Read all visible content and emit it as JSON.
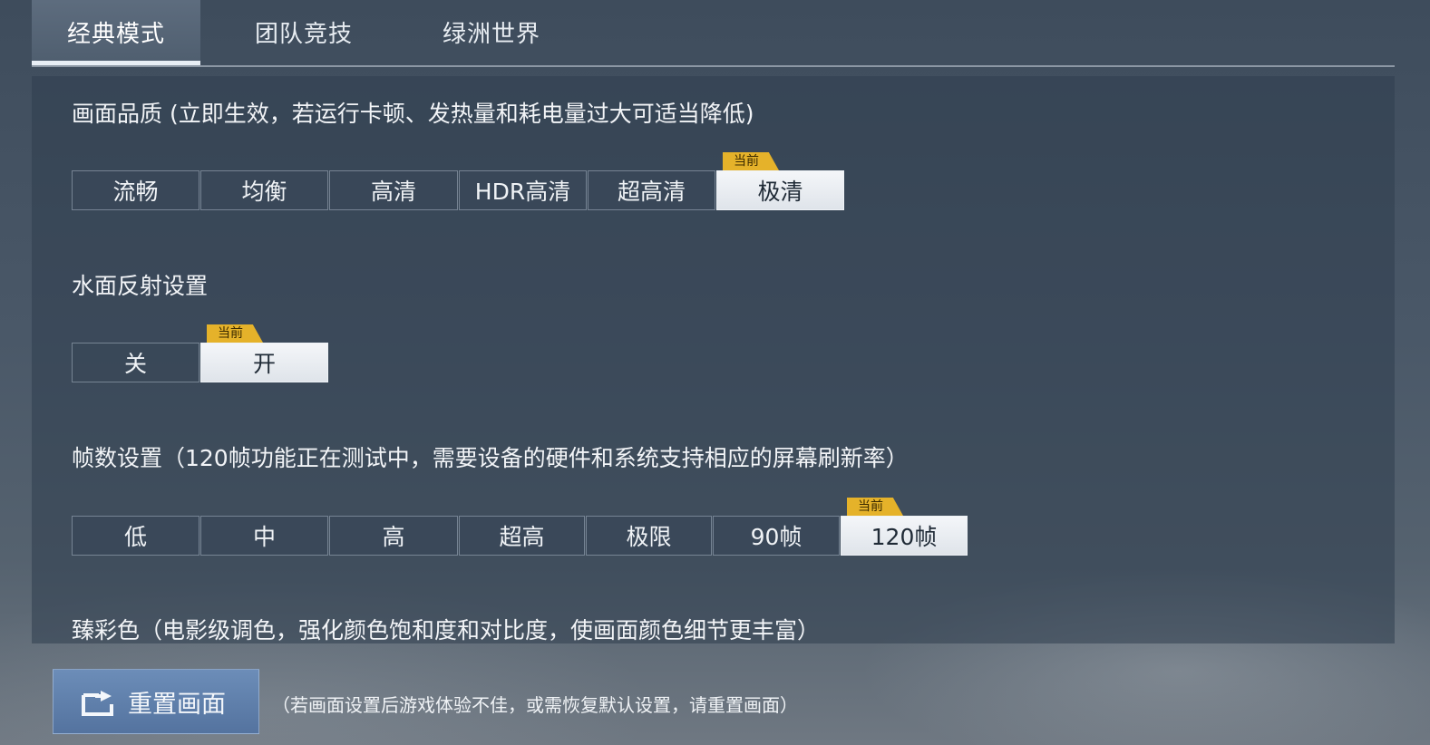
{
  "tabs": [
    "经典模式",
    "团队竞技",
    "绿洲世界"
  ],
  "sections": {
    "quality": {
      "title": "画面品质 (立即生效，若运行卡顿、发热量和耗电量过大可适当降低)",
      "options": [
        "流畅",
        "均衡",
        "高清",
        "HDR高清",
        "超高清",
        "极清"
      ],
      "selected_label": "极清"
    },
    "water": {
      "title": "水面反射设置",
      "options": [
        "关",
        "开"
      ],
      "selected_label": "开"
    },
    "fps": {
      "title": "帧数设置（120帧功能正在测试中，需要设备的硬件和系统支持相应的屏幕刷新率）",
      "options": [
        "低",
        "中",
        "高",
        "超高",
        "极限",
        "90帧",
        "120帧"
      ],
      "selected_label": "120帧"
    },
    "color": {
      "title": "臻彩色（电影级调色，强化颜色饱和度和对比度，使画面颜色细节更丰富）"
    }
  },
  "badge_label": "当前",
  "reset": {
    "label": "重置画面",
    "icon": "reset-screen-icon",
    "hint": "（若画面设置后游戏体验不佳，或需恢复默认设置，请重置画面）"
  },
  "colors": {
    "badge": "#e5b22a",
    "selected_bg": "#f4f6f9",
    "reset_button": "#6c8db8"
  }
}
